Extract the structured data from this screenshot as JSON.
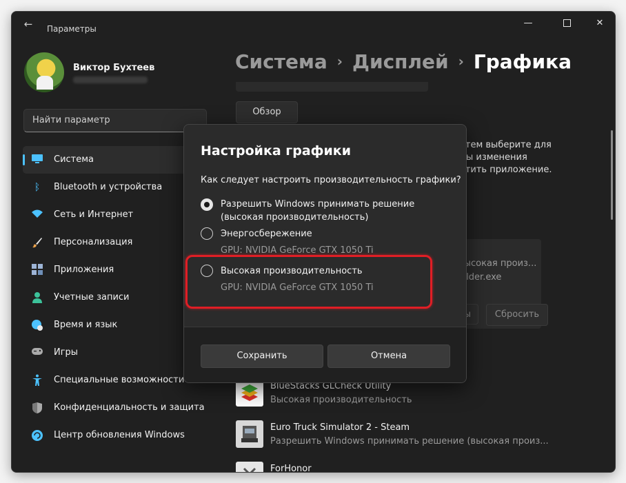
{
  "window": {
    "app_title": "Параметры",
    "controls": {
      "minimize": "—",
      "close": "✕"
    }
  },
  "user": {
    "name": "Виктор Бухтеев"
  },
  "search": {
    "placeholder": "Найти параметр"
  },
  "sidebar": {
    "items": [
      {
        "label": "Система",
        "icon": "system-icon",
        "color": "#4cc2ff",
        "active": true
      },
      {
        "label": "Bluetooth и устройства",
        "icon": "bluetooth-icon",
        "color": "#4cc2ff"
      },
      {
        "label": "Сеть и Интернет",
        "icon": "wifi-icon",
        "color": "#4cc2ff"
      },
      {
        "label": "Персонализация",
        "icon": "brush-icon",
        "color": "#e8a04a"
      },
      {
        "label": "Приложения",
        "icon": "apps-icon",
        "color": "#9db4d6"
      },
      {
        "label": "Учетные записи",
        "icon": "account-icon",
        "color": "#3cc29a"
      },
      {
        "label": "Время и язык",
        "icon": "globe-clock-icon",
        "color": "#4cc2ff"
      },
      {
        "label": "Игры",
        "icon": "gamepad-icon",
        "color": "#aaaaaa"
      },
      {
        "label": "Специальные возможности",
        "icon": "accessibility-icon",
        "color": "#4cc2ff"
      },
      {
        "label": "Конфиденциальность и защита",
        "icon": "shield-icon",
        "color": "#aaaaaa"
      },
      {
        "label": "Центр обновления Windows",
        "icon": "update-icon",
        "color": "#4cc2ff"
      }
    ]
  },
  "breadcrumb": {
    "part1": "Система",
    "part2": "Дисплей",
    "current": "Графика",
    "sep": "›"
  },
  "main": {
    "browse_button": "Обзор",
    "peek_lines": [
      "затем выберите для",
      "обы изменения",
      "устить приложение."
    ],
    "card": {
      "line1": "(высокая произ...",
      "line2": "holder.exe",
      "btn_partial": "ны",
      "reset_button": "Сбросить"
    },
    "apps": [
      {
        "name": "BlueStacks GLCheck Utility",
        "pref": "Высокая производительность",
        "icon": "bluestacks-icon"
      },
      {
        "name": "Euro Truck Simulator 2 - Steam",
        "pref": "Разрешить Windows принимать решение (высокая произ...",
        "icon": "ets2-icon"
      },
      {
        "name": "ForHonor",
        "pref": "",
        "icon": "forhonor-icon"
      }
    ]
  },
  "dialog": {
    "title": "Настройка графики",
    "question": "Как следует настроить производительность графики?",
    "options": [
      {
        "label": "Разрешить Windows принимать решение (высокая производительность)",
        "sub": "",
        "checked": true
      },
      {
        "label": "Энергосбережение",
        "sub": "GPU: NVIDIA GeForce GTX 1050 Ti",
        "checked": false
      },
      {
        "label": "Высокая производительность",
        "sub": "GPU: NVIDIA GeForce GTX 1050 Ti",
        "checked": false
      }
    ],
    "save_button": "Сохранить",
    "cancel_button": "Отмена",
    "highlight_color": "#e01e25"
  }
}
